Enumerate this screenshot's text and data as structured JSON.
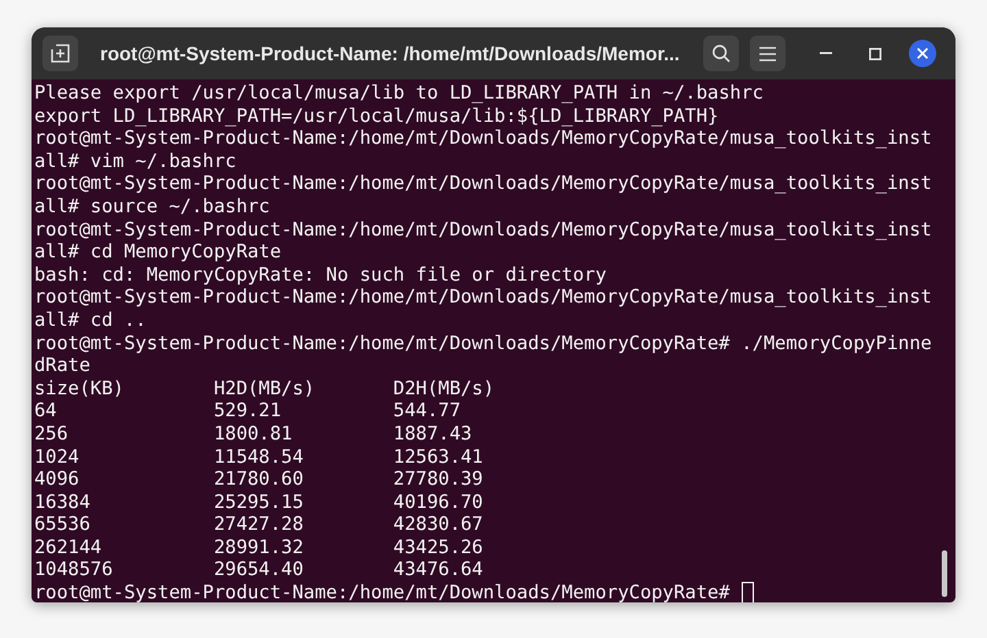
{
  "window": {
    "title": "root@mt-System-Product-Name: /home/mt/Downloads/Memor..."
  },
  "terminal": {
    "lines": [
      "Please export /usr/local/musa/lib to LD_LIBRARY_PATH in ~/.bashrc",
      "export LD_LIBRARY_PATH=/usr/local/musa/lib:${LD_LIBRARY_PATH}",
      "root@mt-System-Product-Name:/home/mt/Downloads/MemoryCopyRate/musa_toolkits_inst",
      "all# vim ~/.bashrc",
      "root@mt-System-Product-Name:/home/mt/Downloads/MemoryCopyRate/musa_toolkits_inst",
      "all# source ~/.bashrc",
      "root@mt-System-Product-Name:/home/mt/Downloads/MemoryCopyRate/musa_toolkits_inst",
      "all# cd MemoryCopyRate",
      "bash: cd: MemoryCopyRate: No such file or directory",
      "root@mt-System-Product-Name:/home/mt/Downloads/MemoryCopyRate/musa_toolkits_inst",
      "all# cd ..",
      "root@mt-System-Product-Name:/home/mt/Downloads/MemoryCopyRate# ./MemoryCopyPinne",
      "dRate",
      "size(KB)        H2D(MB/s)       D2H(MB/s)",
      "64              529.21          544.77",
      "256             1800.81         1887.43",
      "1024            11548.54        12563.41",
      "4096            21780.60        27780.39",
      "16384           25295.15        40196.70",
      "65536           27427.28        42830.67",
      "262144          28991.32        43425.26",
      "1048576         29654.40        43476.64"
    ],
    "prompt": "root@mt-System-Product-Name:/home/mt/Downloads/MemoryCopyRate#",
    "cursor": true
  }
}
